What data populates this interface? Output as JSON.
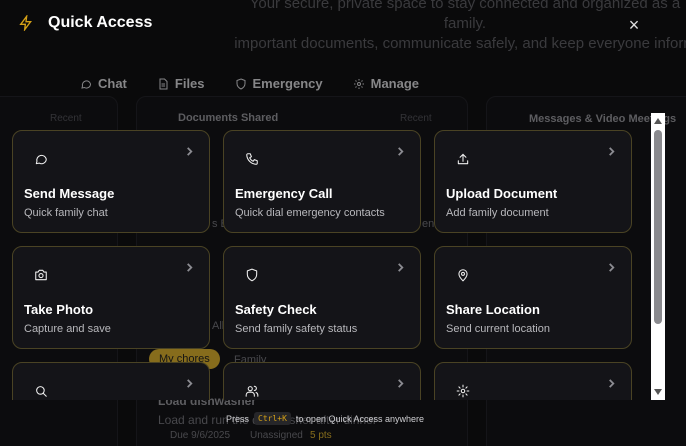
{
  "background": {
    "hero_line1": "Your secure, private space to stay connected and organized as a family.",
    "hero_line2": "important documents, communicate safely, and keep everyone inform",
    "tabs": [
      {
        "label": "Chat",
        "icon": "chat-icon"
      },
      {
        "label": "Files",
        "icon": "file-icon"
      },
      {
        "label": "Emergency",
        "icon": "shield-icon"
      },
      {
        "label": "Manage",
        "icon": "gear-icon"
      }
    ],
    "card_documents_title": "Documents Shared",
    "card_messages_title": "Messages & Video Meetings",
    "recent_label": "Recent",
    "chip_label": "My chores",
    "family_label": "Family",
    "task_title": "Load dishwasher",
    "task_desc": "Load and run the dishwasher after dinner",
    "task_due": "Due 9/6/2025",
    "task_assignee": "Unassigned",
    "task_points": "5 pts",
    "partial_b": "s B",
    "partial_ent": "ent",
    "partial_allo": "Allo"
  },
  "quick_access": {
    "title": "Quick Access",
    "close_symbol": "×",
    "actions": [
      {
        "label": "Send Message",
        "desc": "Quick family chat",
        "icon": "message-icon"
      },
      {
        "label": "Emergency Call",
        "desc": "Quick dial emergency contacts",
        "icon": "phone-icon"
      },
      {
        "label": "Upload Document",
        "desc": "Add family document",
        "icon": "upload-icon"
      },
      {
        "label": "Take Photo",
        "desc": "Capture and save",
        "icon": "camera-icon"
      },
      {
        "label": "Safety Check",
        "desc": "Send family safety status",
        "icon": "shield-icon"
      },
      {
        "label": "Share Location",
        "desc": "Send current location",
        "icon": "location-pin-icon"
      },
      {
        "label": "",
        "desc": "",
        "icon": "search-icon"
      },
      {
        "label": "",
        "desc": "",
        "icon": "users-icon"
      },
      {
        "label": "",
        "desc": "",
        "icon": "gear-icon"
      }
    ],
    "hint_prefix": "Press",
    "hint_key": "Ctrl+K",
    "hint_suffix": "to open Quick Access anywhere"
  },
  "colors": {
    "accent": "#d4a017",
    "card_border": "#4a4324",
    "card_bg": "#141418",
    "page_bg": "#0b0b0d"
  }
}
